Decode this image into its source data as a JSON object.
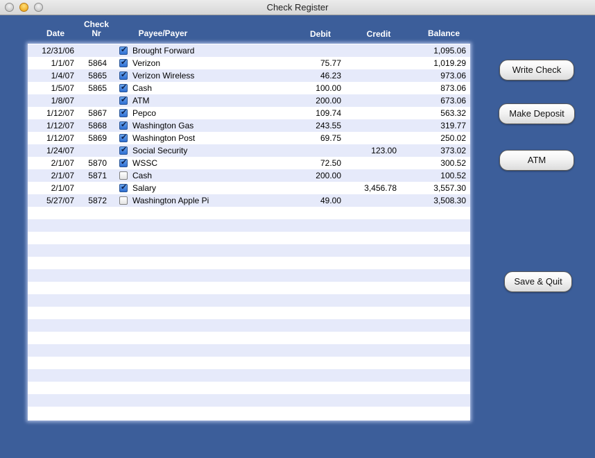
{
  "window": {
    "title": "Check Register"
  },
  "columns": {
    "date": "Date",
    "check_nr": "Check\nNr",
    "payee": "Payee/Payer",
    "debit": "Debit",
    "credit": "Credit",
    "balance": "Balance"
  },
  "rows": [
    {
      "date": "12/31/06",
      "check": "",
      "cleared": true,
      "payee": "Brought Forward",
      "debit": "",
      "credit": "",
      "balance": "1,095.06"
    },
    {
      "date": "1/1/07",
      "check": "5864",
      "cleared": true,
      "payee": "Verizon",
      "debit": "75.77",
      "credit": "",
      "balance": "1,019.29"
    },
    {
      "date": "1/4/07",
      "check": "5865",
      "cleared": true,
      "payee": "Verizon Wireless",
      "debit": "46.23",
      "credit": "",
      "balance": "973.06"
    },
    {
      "date": "1/5/07",
      "check": "5865",
      "cleared": true,
      "payee": "Cash",
      "debit": "100.00",
      "credit": "",
      "balance": "873.06"
    },
    {
      "date": "1/8/07",
      "check": "",
      "cleared": true,
      "payee": "ATM",
      "debit": "200.00",
      "credit": "",
      "balance": "673.06"
    },
    {
      "date": "1/12/07",
      "check": "5867",
      "cleared": true,
      "payee": "Pepco",
      "debit": "109.74",
      "credit": "",
      "balance": "563.32"
    },
    {
      "date": "1/12/07",
      "check": "5868",
      "cleared": true,
      "payee": "Washington Gas",
      "debit": "243.55",
      "credit": "",
      "balance": "319.77"
    },
    {
      "date": "1/12/07",
      "check": "5869",
      "cleared": true,
      "payee": "Washington Post",
      "debit": "69.75",
      "credit": "",
      "balance": "250.02"
    },
    {
      "date": "1/24/07",
      "check": "",
      "cleared": true,
      "payee": "Social Security",
      "debit": "",
      "credit": "123.00",
      "balance": "373.02"
    },
    {
      "date": "2/1/07",
      "check": "5870",
      "cleared": true,
      "payee": "WSSC",
      "debit": "72.50",
      "credit": "",
      "balance": "300.52"
    },
    {
      "date": "2/1/07",
      "check": "5871",
      "cleared": false,
      "payee": "Cash",
      "debit": "200.00",
      "credit": "",
      "balance": "100.52"
    },
    {
      "date": "2/1/07",
      "check": "",
      "cleared": true,
      "payee": "Salary",
      "debit": "",
      "credit": "3,456.78",
      "balance": "3,557.30"
    },
    {
      "date": "5/27/07",
      "check": "5872",
      "cleared": false,
      "payee": "Washington Apple Pi",
      "debit": "49.00",
      "credit": "",
      "balance": "3,508.30"
    }
  ],
  "buttons": {
    "write_check": "Write Check",
    "make_deposit": "Make Deposit",
    "atm": "ATM",
    "save_quit": "Save & Quit"
  },
  "colors": {
    "background": "#3c5e9a",
    "row_stripe": "#e6eafa",
    "row_plain": "#ffffff"
  }
}
